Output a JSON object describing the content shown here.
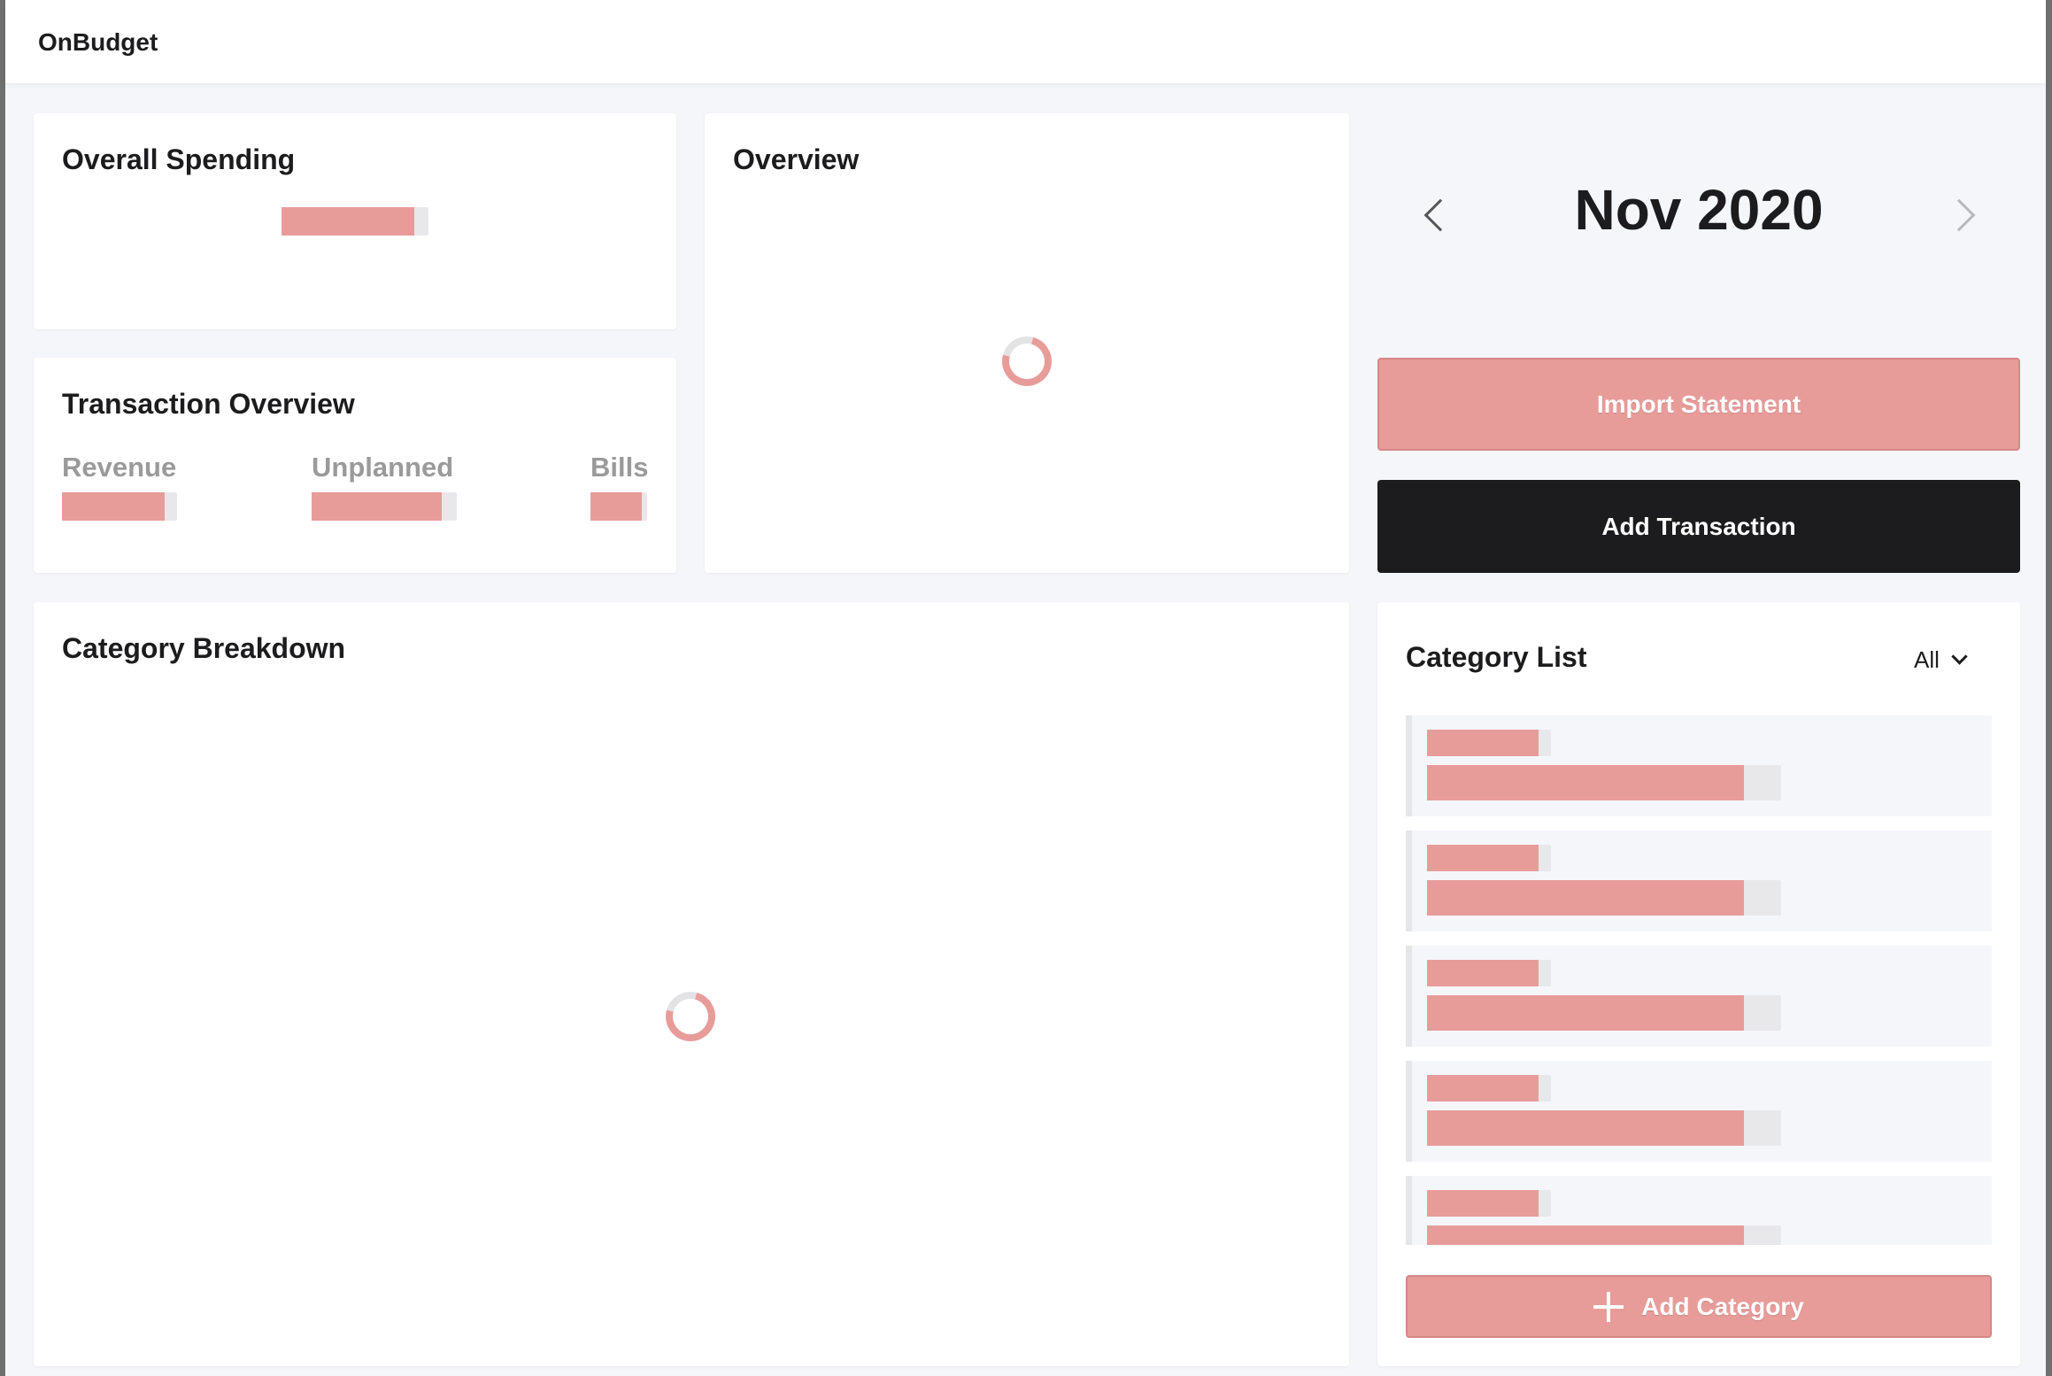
{
  "app": {
    "brand": "OnBudget"
  },
  "cards": {
    "overall_spending": {
      "title": "Overall Spending"
    },
    "overview": {
      "title": "Overview"
    },
    "transaction_overview": {
      "title": "Transaction Overview",
      "labels": {
        "revenue": "Revenue",
        "unplanned": "Unplanned",
        "bills": "Bills"
      }
    },
    "category_breakdown": {
      "title": "Category Breakdown"
    },
    "category_list": {
      "title": "Category List",
      "filter_label": "All"
    }
  },
  "month_nav": {
    "current": "Nov 2020"
  },
  "actions": {
    "import_statement": "Import Statement",
    "add_transaction": "Add Transaction",
    "add_category": "Add Category"
  },
  "colors": {
    "accent": "#e89c9a",
    "dark": "#1c1c1e",
    "skeleton_track": "#e8e8ea",
    "background": "#f5f6fa"
  },
  "icons": [
    "chevron-left-icon",
    "chevron-right-icon",
    "chevron-down-icon",
    "plus-icon",
    "loading-spinner-icon"
  ]
}
